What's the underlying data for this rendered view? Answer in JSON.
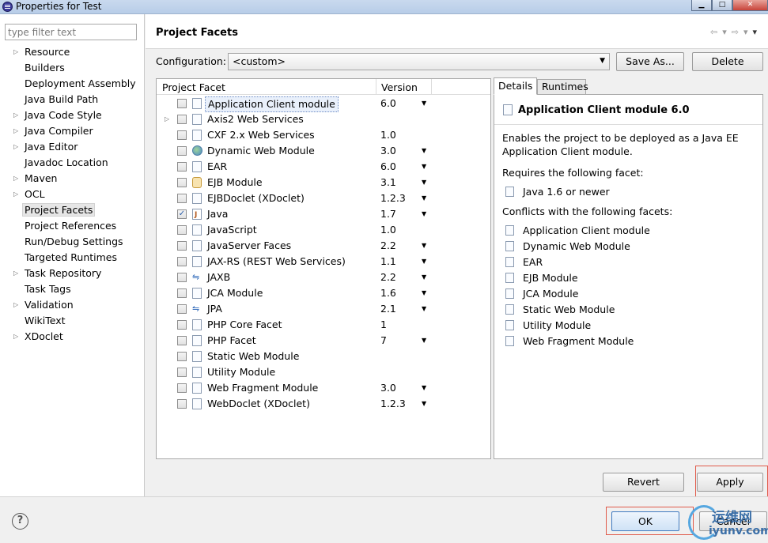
{
  "window": {
    "title": "Properties for Test"
  },
  "filter": {
    "placeholder": "type filter text"
  },
  "tree": [
    {
      "label": "Resource",
      "expandable": true
    },
    {
      "label": "Builders",
      "expandable": false
    },
    {
      "label": "Deployment Assembly",
      "expandable": false
    },
    {
      "label": "Java Build Path",
      "expandable": false
    },
    {
      "label": "Java Code Style",
      "expandable": true
    },
    {
      "label": "Java Compiler",
      "expandable": true
    },
    {
      "label": "Java Editor",
      "expandable": true
    },
    {
      "label": "Javadoc Location",
      "expandable": false
    },
    {
      "label": "Maven",
      "expandable": true
    },
    {
      "label": "OCL",
      "expandable": true
    },
    {
      "label": "Project Facets",
      "expandable": false,
      "selected": true
    },
    {
      "label": "Project References",
      "expandable": false
    },
    {
      "label": "Run/Debug Settings",
      "expandable": false
    },
    {
      "label": "Targeted Runtimes",
      "expandable": false
    },
    {
      "label": "Task Repository",
      "expandable": true
    },
    {
      "label": "Task Tags",
      "expandable": false
    },
    {
      "label": "Validation",
      "expandable": true
    },
    {
      "label": "WikiText",
      "expandable": false
    },
    {
      "label": "XDoclet",
      "expandable": true
    }
  ],
  "header": {
    "title": "Project Facets"
  },
  "configuration": {
    "label": "Configuration:",
    "value": "<custom>",
    "save_as": "Save As...",
    "delete": "Delete"
  },
  "facets": {
    "col_facet": "Project Facet",
    "col_version": "Version",
    "rows": [
      {
        "name": "Application Client module",
        "version": "6.0",
        "dropdown": true,
        "checked": false,
        "icon": "page-icon",
        "selected": true
      },
      {
        "name": "Axis2 Web Services",
        "version": "",
        "dropdown": false,
        "checked": false,
        "icon": "page-icon",
        "expandable": true
      },
      {
        "name": "CXF 2.x Web Services",
        "version": "1.0",
        "dropdown": false,
        "checked": false,
        "icon": "page-icon"
      },
      {
        "name": "Dynamic Web Module",
        "version": "3.0",
        "dropdown": true,
        "checked": false,
        "icon": "globe-icon"
      },
      {
        "name": "EAR",
        "version": "6.0",
        "dropdown": true,
        "checked": false,
        "icon": "page-icon"
      },
      {
        "name": "EJB Module",
        "version": "3.1",
        "dropdown": true,
        "checked": false,
        "icon": "bean-icon"
      },
      {
        "name": "EJBDoclet (XDoclet)",
        "version": "1.2.3",
        "dropdown": true,
        "checked": false,
        "icon": "page-icon"
      },
      {
        "name": "Java",
        "version": "1.7",
        "dropdown": true,
        "checked": true,
        "icon": "java-icon"
      },
      {
        "name": "JavaScript",
        "version": "1.0",
        "dropdown": false,
        "checked": false,
        "icon": "page-icon"
      },
      {
        "name": "JavaServer Faces",
        "version": "2.2",
        "dropdown": true,
        "checked": false,
        "icon": "page-icon"
      },
      {
        "name": "JAX-RS (REST Web Services)",
        "version": "1.1",
        "dropdown": true,
        "checked": false,
        "icon": "page-icon"
      },
      {
        "name": "JAXB",
        "version": "2.2",
        "dropdown": true,
        "checked": false,
        "icon": "arrows-icon"
      },
      {
        "name": "JCA Module",
        "version": "1.6",
        "dropdown": true,
        "checked": false,
        "icon": "page-icon"
      },
      {
        "name": "JPA",
        "version": "2.1",
        "dropdown": true,
        "checked": false,
        "icon": "arrows-icon"
      },
      {
        "name": "PHP Core Facet",
        "version": "1",
        "dropdown": false,
        "checked": false,
        "icon": "page-icon"
      },
      {
        "name": "PHP Facet",
        "version": "7",
        "dropdown": true,
        "checked": false,
        "icon": "page-icon"
      },
      {
        "name": "Static Web Module",
        "version": "",
        "dropdown": false,
        "checked": false,
        "icon": "page-icon"
      },
      {
        "name": "Utility Module",
        "version": "",
        "dropdown": false,
        "checked": false,
        "icon": "page-icon"
      },
      {
        "name": "Web Fragment Module",
        "version": "3.0",
        "dropdown": true,
        "checked": false,
        "icon": "page-icon"
      },
      {
        "name": "WebDoclet (XDoclet)",
        "version": "1.2.3",
        "dropdown": true,
        "checked": false,
        "icon": "page-icon"
      }
    ]
  },
  "details": {
    "tab_details": "Details",
    "tab_runtimes": "Runtimes",
    "heading": "Application Client module 6.0",
    "description": "Enables the project to be deployed as a Java EE Application Client module.",
    "requires_label": "Requires the following facet:",
    "requires": [
      "Java 1.6 or newer"
    ],
    "conflicts_label": "Conflicts with the following facets:",
    "conflicts": [
      "Application Client module",
      "Dynamic Web Module",
      "EAR",
      "EJB Module",
      "JCA Module",
      "Static Web Module",
      "Utility Module",
      "Web Fragment Module"
    ]
  },
  "buttons": {
    "revert": "Revert",
    "apply": "Apply",
    "ok": "OK",
    "cancel": "Cancel"
  },
  "watermark": {
    "line1": "运维网",
    "line2": "iyunv.com"
  }
}
